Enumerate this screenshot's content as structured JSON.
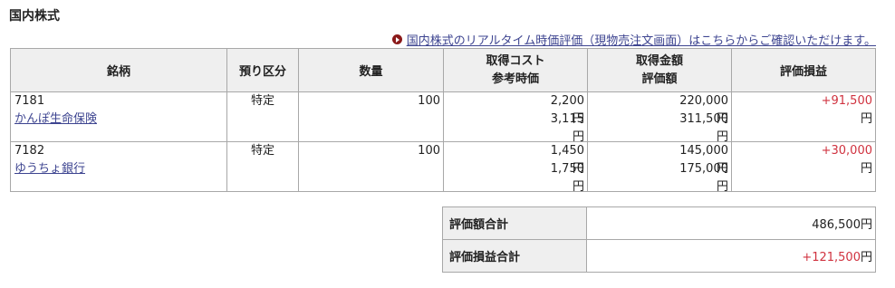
{
  "section_title": "国内株式",
  "realtime_link": "国内株式のリアルタイム時価評価（現物売注文画面）はこちらからご確認いただけます。",
  "headers": {
    "name": "銘柄",
    "custody": "預り区分",
    "quantity": "数量",
    "cost_line1": "取得コスト",
    "cost_line2": "参考時価",
    "amount_line1": "取得金額",
    "amount_line2": "評価額",
    "pl": "評価損益"
  },
  "currency": "円",
  "holdings": [
    {
      "code": "7181",
      "name": "かんぽ生命保険",
      "custody": "特定",
      "quantity": "100",
      "cost": "2,200",
      "ref_price": "3,115",
      "acq_amount": "220,000",
      "eval_amount": "311,500",
      "pl": "+91,500"
    },
    {
      "code": "7182",
      "name": "ゆうちょ銀行",
      "custody": "特定",
      "quantity": "100",
      "cost": "1,450",
      "ref_price": "1,750",
      "acq_amount": "145,000",
      "eval_amount": "175,000",
      "pl": "+30,000"
    }
  ],
  "summary": {
    "eval_total_label": "評価額合計",
    "eval_total": "486,500",
    "pl_total_label": "評価損益合計",
    "pl_total": "+121,500"
  },
  "colors": {
    "gain": "#d0323f",
    "link": "#3d4490",
    "header_bg": "#efefef",
    "border": "#a8a8a8"
  }
}
